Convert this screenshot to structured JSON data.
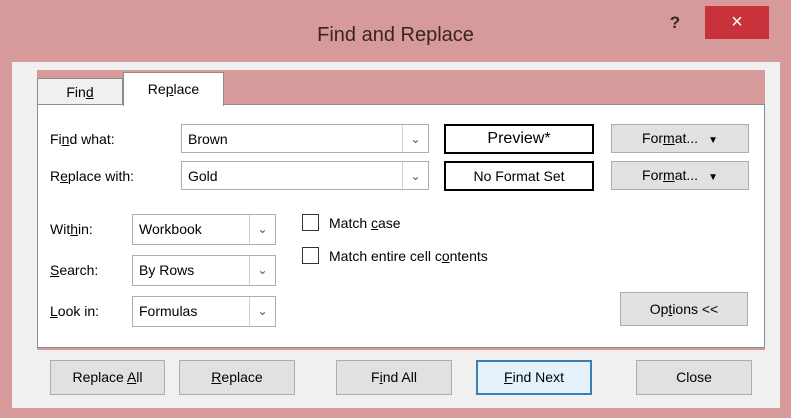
{
  "window": {
    "title": "Find and Replace",
    "help": "?",
    "close": "×"
  },
  "tabs": [
    {
      "label_pre": "Fin",
      "label_key": "d",
      "label_post": "",
      "active": false
    },
    {
      "label_pre": "Re",
      "label_key": "p",
      "label_post": "lace",
      "active": true
    }
  ],
  "find_what": {
    "label_pre": "Fi",
    "label_key": "n",
    "label_post": "d what:",
    "value": "Brown",
    "preview": "Preview*",
    "format_pre": "For",
    "format_key": "m",
    "format_post": "at..."
  },
  "replace_with": {
    "label_pre": "R",
    "label_key": "e",
    "label_post": "place with:",
    "value": "Gold",
    "preview": "No Format Set",
    "format_pre": "For",
    "format_key": "m",
    "format_post": "at..."
  },
  "within": {
    "label_pre": "Wit",
    "label_key": "h",
    "label_post": "in:",
    "value": "Workbook"
  },
  "search": {
    "label_pre": "",
    "label_key": "S",
    "label_post": "earch:",
    "value": "By Rows"
  },
  "look_in": {
    "label_pre": "",
    "label_key": "L",
    "label_post": "ook in:",
    "value": "Formulas"
  },
  "options": {
    "match_case_pre": "Match ",
    "match_case_key": "c",
    "match_case_post": "ase",
    "match_case": false,
    "match_entire_pre": "Match entire cell c",
    "match_entire_key": "o",
    "match_entire_post": "ntents",
    "match_entire": false
  },
  "options_button": {
    "pre": "Op",
    "key": "t",
    "post": "ions <<"
  },
  "buttons": {
    "replace_all_pre": "Replace ",
    "replace_all_key": "A",
    "replace_all_post": "ll",
    "replace_pre": "",
    "replace_key": "R",
    "replace_post": "eplace",
    "find_all_pre": "F",
    "find_all_key": "i",
    "find_all_post": "nd All",
    "find_next_pre": "",
    "find_next_key": "F",
    "find_next_post": "ind Next",
    "close": "Close"
  }
}
